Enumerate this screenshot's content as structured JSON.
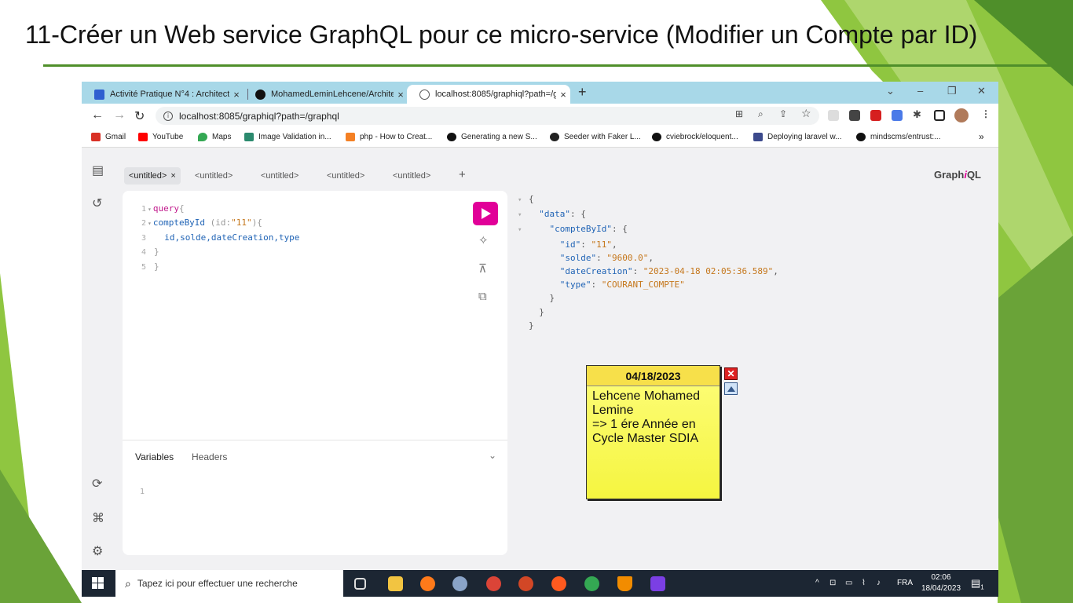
{
  "slide": {
    "title": "11-Créer un Web service GraphQL pour ce micro-service (Modifier un Compte par ID)"
  },
  "browser": {
    "tabs": [
      {
        "label": "Activité Pratique N°4 : Architectu",
        "icon": "document-icon",
        "color": "#2f5fd0"
      },
      {
        "label": "MohamedLeminLehcene/Archite",
        "icon": "github-icon",
        "color": "#111111"
      },
      {
        "label": "localhost:8085/graphiql?path=/g",
        "icon": "globe-icon",
        "color": "#555555"
      }
    ],
    "address": "localhost:8085/graphiql?path=/graphql",
    "bookmarks": [
      {
        "label": "Gmail",
        "color": "#d93025"
      },
      {
        "label": "YouTube",
        "color": "#ff0000"
      },
      {
        "label": "Maps",
        "color": "#34a853"
      },
      {
        "label": "Image Validation in...",
        "color": "#2b8a6e"
      },
      {
        "label": "php - How to Creat...",
        "color": "#f48024"
      },
      {
        "label": "Generating a new S...",
        "color": "#111111"
      },
      {
        "label": "Seeder with Faker L...",
        "color": "#222222"
      },
      {
        "label": "cviebrock/eloquent...",
        "color": "#111111"
      },
      {
        "label": "Deploying laravel w...",
        "color": "#3c4a8c"
      },
      {
        "label": "mindscms/entrust:...",
        "color": "#111111"
      }
    ],
    "more_bookmarks": "»"
  },
  "graphiql": {
    "tabs": [
      "<untitled>",
      "<untitled>",
      "<untitled>",
      "<untitled>",
      "<untitled>"
    ],
    "tab_close": "×",
    "add_tab": "+",
    "logo_prefix": "Graph",
    "logo_i": "i",
    "logo_suffix": "QL",
    "query_lines": [
      {
        "n": "1",
        "fold": "▾",
        "a": "query",
        "b": "{"
      },
      {
        "n": "2",
        "fold": "▾",
        "a": "compteById",
        "b": " (id:",
        "c": "\"11\"",
        "d": "){"
      },
      {
        "n": "3",
        "fold": "",
        "a": "  id,solde,dateCreation,type"
      },
      {
        "n": "4",
        "fold": "",
        "a": "}"
      },
      {
        "n": "5",
        "fold": "",
        "a": "}"
      }
    ],
    "variables_tab": "Variables",
    "headers_tab": "Headers",
    "variables_line": "1",
    "result": {
      "id": "\"11\"",
      "solde": "\"9600.0\"",
      "dateCreation": "\"2023-04-18 02:05:36.589\"",
      "type": "\"COURANT_COMPTE\""
    }
  },
  "sticky": {
    "date": "04/18/2023",
    "text": "Lehcene Mohamed\nLemine\n=> 1 ére Année en\nCycle Master SDIA",
    "close": "✕"
  },
  "taskbar": {
    "search_placeholder": "Tapez ici pour effectuer une recherche",
    "language": "FRA",
    "time": "02:06",
    "date": "18/04/2023",
    "notif_count": "1"
  }
}
